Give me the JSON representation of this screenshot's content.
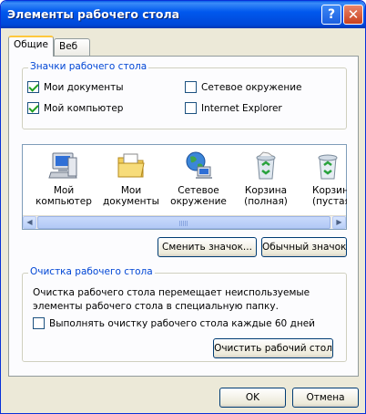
{
  "window": {
    "title": "Элементы рабочего стола",
    "help_glyph": "?",
    "close_glyph": "✕"
  },
  "tabs": [
    {
      "label": "Общие",
      "active": true
    },
    {
      "label": "Веб",
      "active": false
    }
  ],
  "desktop_icons_group": {
    "title": "Значки рабочего стола",
    "checkboxes": [
      {
        "label": "Мои документы",
        "checked": true
      },
      {
        "label": "Сетевое окружение",
        "checked": false
      },
      {
        "label": "Мой компьютер",
        "checked": true
      },
      {
        "label": "Internet Explorer",
        "checked": false
      }
    ]
  },
  "icon_list": [
    {
      "line1": "Мой",
      "line2": "компьютер",
      "icon": "my-computer-icon"
    },
    {
      "line1": "Мои",
      "line2": "документы",
      "icon": "my-documents-icon"
    },
    {
      "line1": "Сетевое",
      "line2": "окружение",
      "icon": "network-places-icon"
    },
    {
      "line1": "Корзина",
      "line2": "(полная)",
      "icon": "recycle-bin-full-icon"
    },
    {
      "line1": "Корзина",
      "line2": "(пустая)",
      "icon": "recycle-bin-empty-icon"
    }
  ],
  "buttons": {
    "change_icon": "Сменить значок...",
    "default_icon": "Обычный значок",
    "clean_now": "Очистить рабочий стол",
    "ok": "OK",
    "cancel": "Отмена"
  },
  "cleanup_group": {
    "title": "Очистка рабочего стола",
    "description": "Очистка рабочего стола перемещает неиспользуемые элементы рабочего стола в специальную папку.",
    "checkbox_label": "Выполнять очистку рабочего стола каждые 60 дней",
    "checkbox_checked": false
  },
  "scrollbar": {
    "left_glyph": "◀",
    "right_glyph": "▶"
  }
}
